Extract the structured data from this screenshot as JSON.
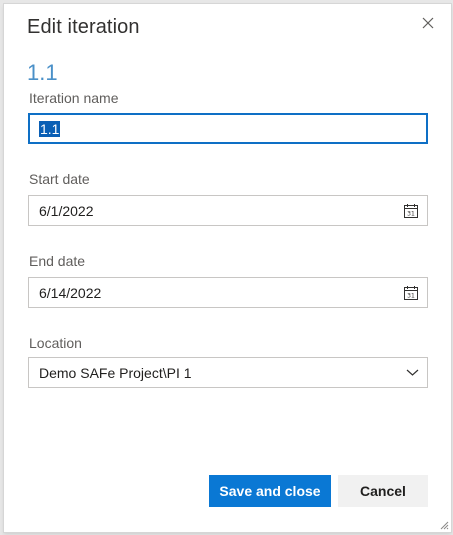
{
  "dialog": {
    "title": "Edit iteration",
    "subtitle": "1.1"
  },
  "fields": {
    "iteration_name": {
      "label": "Iteration name",
      "value": "1.1"
    },
    "start_date": {
      "label": "Start date",
      "value": "6/1/2022",
      "icon": "calendar-icon"
    },
    "end_date": {
      "label": "End date",
      "value": "6/14/2022",
      "icon": "calendar-icon"
    },
    "location": {
      "label": "Location",
      "value": "Demo SAFe Project\\PI 1",
      "icon": "chevron-down-icon"
    }
  },
  "buttons": {
    "save_label": "Save and close",
    "cancel_label": "Cancel"
  },
  "icons": {
    "close": "close-icon",
    "resize": "resize-grip-icon"
  },
  "colors": {
    "primary": "#0a78d4",
    "focus_border": "#0e6fc5",
    "selection": "#0a5fb5",
    "subtitle": "#4a90c8"
  }
}
